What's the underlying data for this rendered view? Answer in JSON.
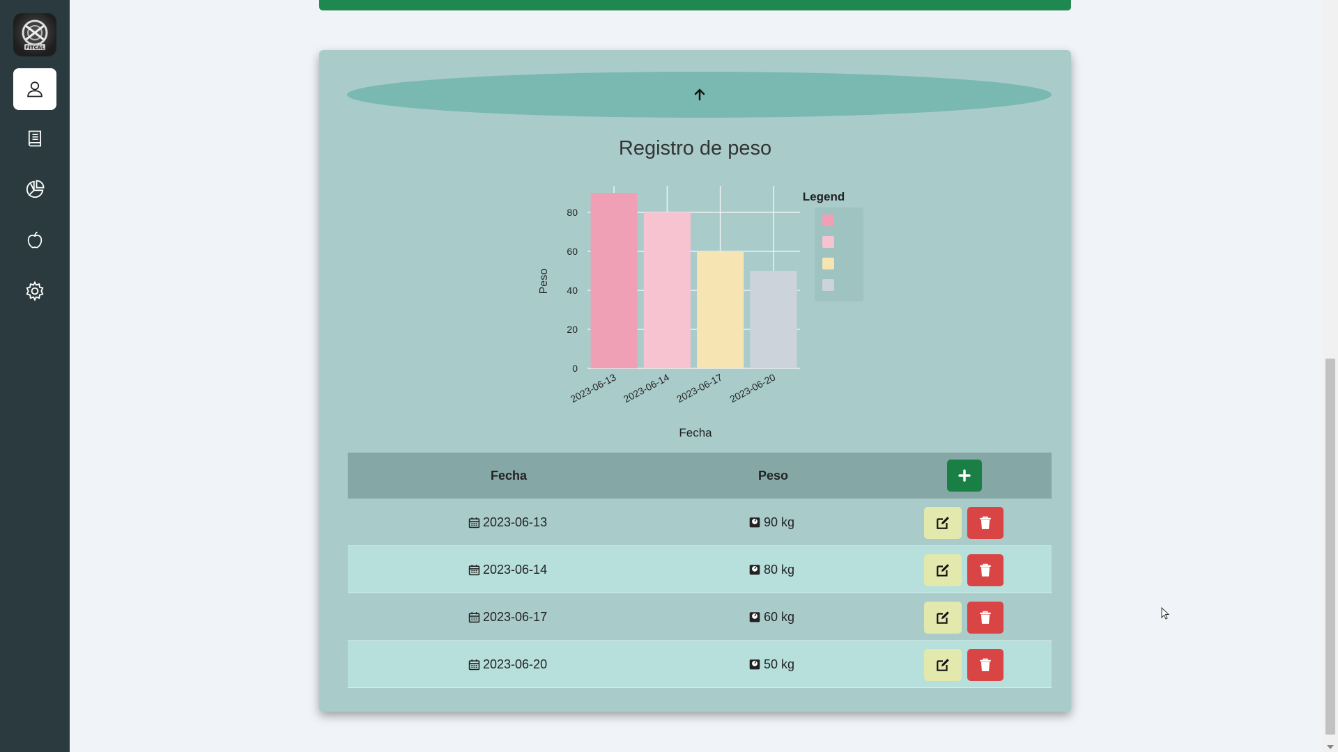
{
  "sidebar": {
    "logo_text": "FITCAL",
    "items": [
      {
        "icon": "user-icon",
        "active": true
      },
      {
        "icon": "book-icon",
        "active": false
      },
      {
        "icon": "chart-pie-icon",
        "active": false
      },
      {
        "icon": "apple-icon",
        "active": false
      },
      {
        "icon": "gear-icon",
        "active": false
      }
    ]
  },
  "colors": {
    "sidebar": "#2b3a3e",
    "card": "#a9cccb",
    "header": "#85a7a5",
    "add": "#1a7f45",
    "edit": "#e3e8ad",
    "delete": "#d94444"
  },
  "chart_data": {
    "type": "bar",
    "title": "Registro de peso",
    "xlabel": "Fecha",
    "ylabel": "Peso",
    "categories": [
      "2023-06-13",
      "2023-06-14",
      "2023-06-17",
      "2023-06-20"
    ],
    "values": [
      90,
      80,
      60,
      50
    ],
    "bar_colors": [
      "#f0a0b4",
      "#f8c3d0",
      "#f7e4b3",
      "#cdd3db"
    ],
    "yticks": [
      0,
      20,
      40,
      60,
      80
    ],
    "ylim": [
      0,
      90
    ],
    "legend_title": "Legend",
    "legend_position": "right",
    "grid": true
  },
  "table": {
    "headers": {
      "fecha": "Fecha",
      "peso": "Peso"
    },
    "rows": [
      {
        "fecha": "2023-06-13",
        "peso": "90 kg"
      },
      {
        "fecha": "2023-06-14",
        "peso": "80 kg"
      },
      {
        "fecha": "2023-06-17",
        "peso": "60 kg"
      },
      {
        "fecha": "2023-06-20",
        "peso": "50 kg"
      }
    ]
  }
}
